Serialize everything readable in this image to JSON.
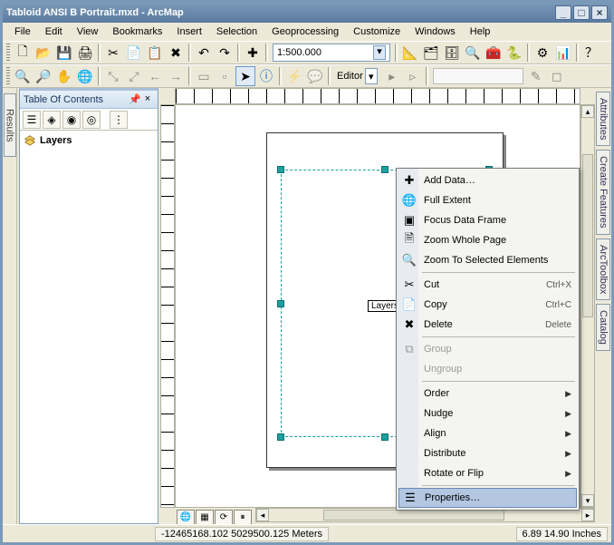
{
  "title": "Tabloid ANSI B Portrait.mxd - ArcMap",
  "menus": {
    "file": "File",
    "edit": "Edit",
    "view": "View",
    "bookmarks": "Bookmarks",
    "insert": "Insert",
    "selection": "Selection",
    "geoprocessing": "Geoprocessing",
    "customize": "Customize",
    "windows": "Windows",
    "help": "Help"
  },
  "scale": "1:500.000",
  "editor_label": "Editor",
  "toc": {
    "title": "Table Of Contents",
    "root": "Layers"
  },
  "layers_tag": "Layers",
  "ctx": {
    "adddata": "Add Data…",
    "fullextent": "Full Extent",
    "focusdf": "Focus Data Frame",
    "zoomwhole": "Zoom Whole Page",
    "zoomsel": "Zoom To Selected Elements",
    "cut": "Cut",
    "cut_sc": "Ctrl+X",
    "copy": "Copy",
    "copy_sc": "Ctrl+C",
    "delete": "Delete",
    "delete_sc": "Delete",
    "group": "Group",
    "ungroup": "Ungroup",
    "order": "Order",
    "nudge": "Nudge",
    "align": "Align",
    "distribute": "Distribute",
    "rotate": "Rotate or Flip",
    "properties": "Properties…"
  },
  "rightdock": {
    "attributes": "Attributes",
    "createfeat": "Create Features",
    "arctoolbox": "ArcToolbox",
    "catalog": "Catalog"
  },
  "status": {
    "coords": "-12465168.102 5029500.125 Meters",
    "inches": "6.89 14.90 Inches"
  },
  "leftdock": {
    "results": "Results"
  }
}
